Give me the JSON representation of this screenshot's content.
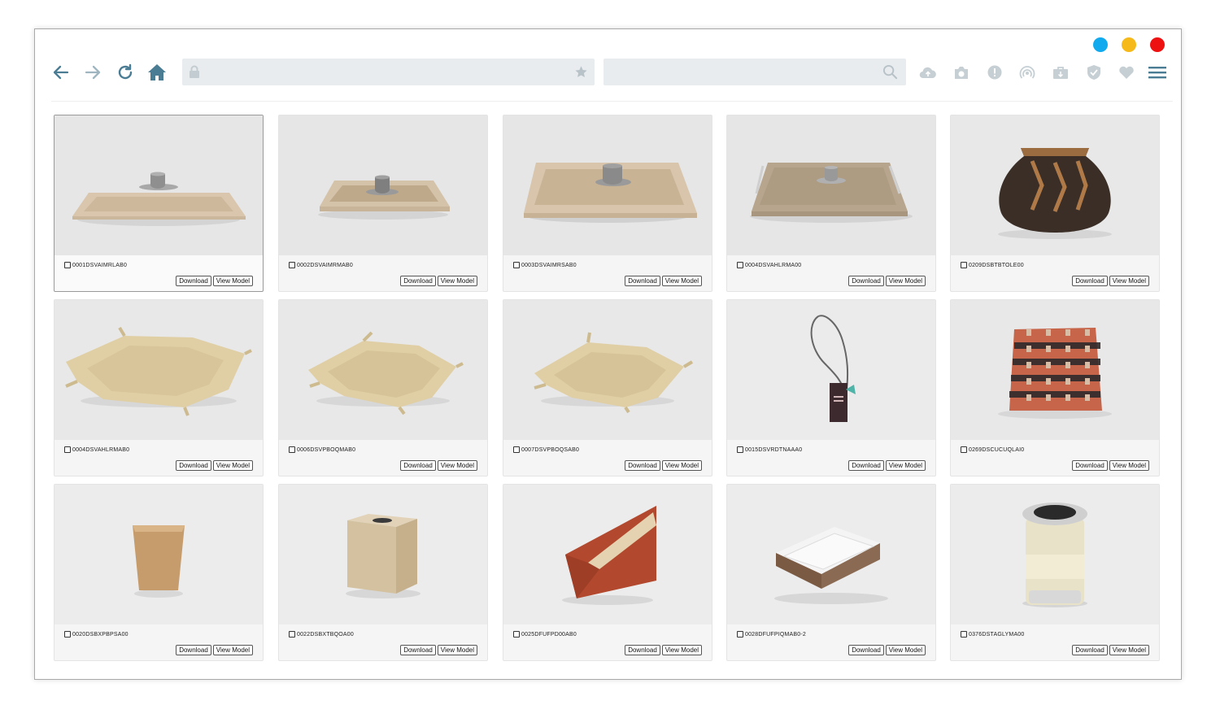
{
  "window": {
    "controls": [
      {
        "name": "blue",
        "color": "#11aaee"
      },
      {
        "name": "yellow",
        "color": "#f6b91a"
      },
      {
        "name": "red",
        "color": "#ee1111"
      }
    ]
  },
  "toolbar": {
    "address_value": "",
    "search_value": "",
    "accent_color": "#4a7c94",
    "ext_icon_color": "#c5cfd4"
  },
  "products": [
    {
      "code": "0001DSVAIMRLAB0",
      "download": "Download",
      "view": "View Model",
      "image": "tray-light"
    },
    {
      "code": "0002DSVAIMRMAB0",
      "download": "Download",
      "view": "View Model",
      "image": "tray-small"
    },
    {
      "code": "0003DSVAIMRSAB0",
      "download": "Download",
      "view": "View Model",
      "image": "tray-deep"
    },
    {
      "code": "0004DSVAHLRMA00",
      "download": "Download",
      "view": "View Model",
      "image": "tray-handles"
    },
    {
      "code": "0209DSBTBTOLE00",
      "download": "Download",
      "view": "View Model",
      "image": "lantern"
    },
    {
      "code": "0004DSVAHLRMAB0",
      "download": "Download",
      "view": "View Model",
      "image": "valet-tray-large"
    },
    {
      "code": "0006DSVPBOQMAB0",
      "download": "Download",
      "view": "View Model",
      "image": "valet-tray-medium"
    },
    {
      "code": "0007DSVPBOQSAB0",
      "download": "Download",
      "view": "View Model",
      "image": "valet-tray-small"
    },
    {
      "code": "0015DSVRDTNAAA0",
      "download": "Download",
      "view": "View Model",
      "image": "door-hanger"
    },
    {
      "code": "0269DSCUCUQLAI0",
      "download": "Download",
      "view": "View Model",
      "image": "cushion"
    },
    {
      "code": "0020DSBXPBPSA00",
      "download": "Download",
      "view": "View Model",
      "image": "waste-bin"
    },
    {
      "code": "0022DSBXTBQOA00",
      "download": "Download",
      "view": "View Model",
      "image": "tissue-box"
    },
    {
      "code": "0025DFUFPD00AB0",
      "download": "Download",
      "view": "View Model",
      "image": "magazine-holder"
    },
    {
      "code": "0028DFUFPIQMAB0-2",
      "download": "Download",
      "view": "View Model",
      "image": "memo-holder"
    },
    {
      "code": "0376DSTAGLYMA00",
      "download": "Download",
      "view": "View Model",
      "image": "ice-bucket"
    }
  ]
}
